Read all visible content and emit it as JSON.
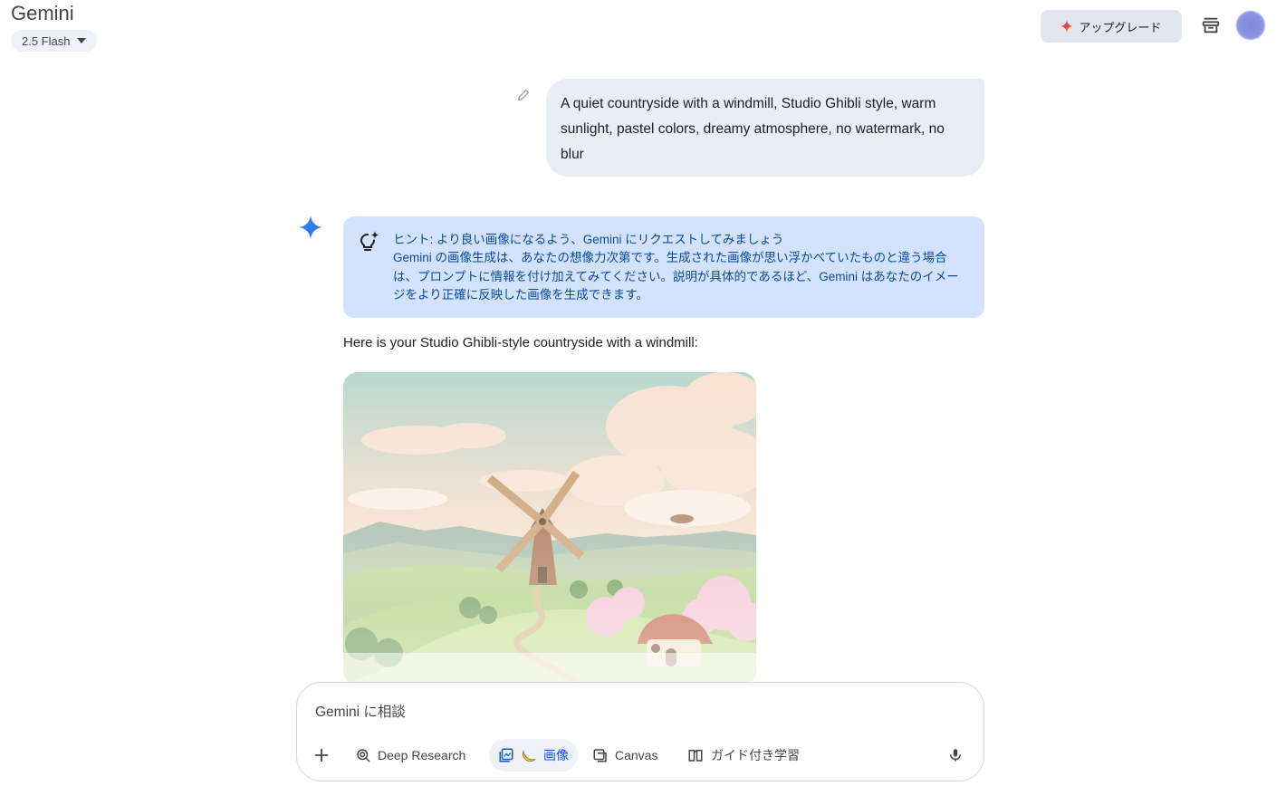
{
  "header": {
    "title": "Gemini",
    "model": "2.5 Flash",
    "upgrade_label": "アップグレード"
  },
  "conversation": {
    "user_prompt": "A quiet countryside with a windmill, Studio Ghibli style, warm sunlight, pastel colors, dreamy atmosphere, no watermark, no blur",
    "hint": {
      "title": "ヒント: より良い画像になるよう、Gemini にリクエストしてみましょう",
      "body": "Gemini の画像生成は、あなたの想像力次第です。生成された画像が思い浮かべていたものと違う場合は、プロンプトに情報を付け加えてみてください。説明が具体的であるほど、Gemini はあなたのイメージをより正確に反映した画像を生成できます。"
    },
    "response_text": "Here is your Studio Ghibli-style countryside with a windmill:"
  },
  "composer": {
    "placeholder": "Gemini に相談",
    "tools": {
      "deep_research": "Deep Research",
      "image": "画像",
      "canvas": "Canvas",
      "guided_learning": "ガイド付き学習"
    }
  },
  "icons": {
    "spark": "gemini-spark-icon",
    "hint": "lightbulb-sparkle-icon",
    "edit": "pencil-icon",
    "archive": "archive-icon",
    "mic": "microphone-icon",
    "plus": "plus-icon"
  },
  "colors": {
    "accent": "#0b57d0",
    "hint_background": "#d3e3fd",
    "user_bubble": "#e9eef6",
    "spark": "#4285f4"
  }
}
